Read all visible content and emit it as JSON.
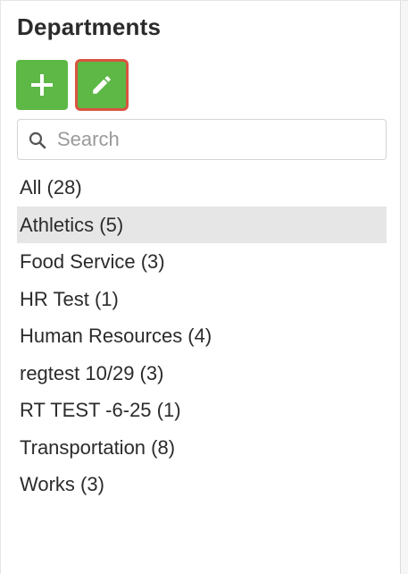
{
  "header": {
    "title": "Departments"
  },
  "toolbar": {
    "add_icon": "plus-icon",
    "edit_icon": "pencil-icon",
    "button_color": "#5db846",
    "highlight_color": "#d9543f"
  },
  "search": {
    "placeholder": "Search",
    "value": "",
    "icon": "search-icon"
  },
  "departments": [
    {
      "label": "All (28)",
      "selected": false
    },
    {
      "label": "Athletics (5)",
      "selected": true
    },
    {
      "label": "Food Service (3)",
      "selected": false
    },
    {
      "label": "HR Test (1)",
      "selected": false
    },
    {
      "label": "Human Resources (4)",
      "selected": false
    },
    {
      "label": "regtest 10/29 (3)",
      "selected": false
    },
    {
      "label": "RT TEST -6-25 (1)",
      "selected": false
    },
    {
      "label": "Transportation (8)",
      "selected": false
    },
    {
      "label": "Works (3)",
      "selected": false
    }
  ]
}
